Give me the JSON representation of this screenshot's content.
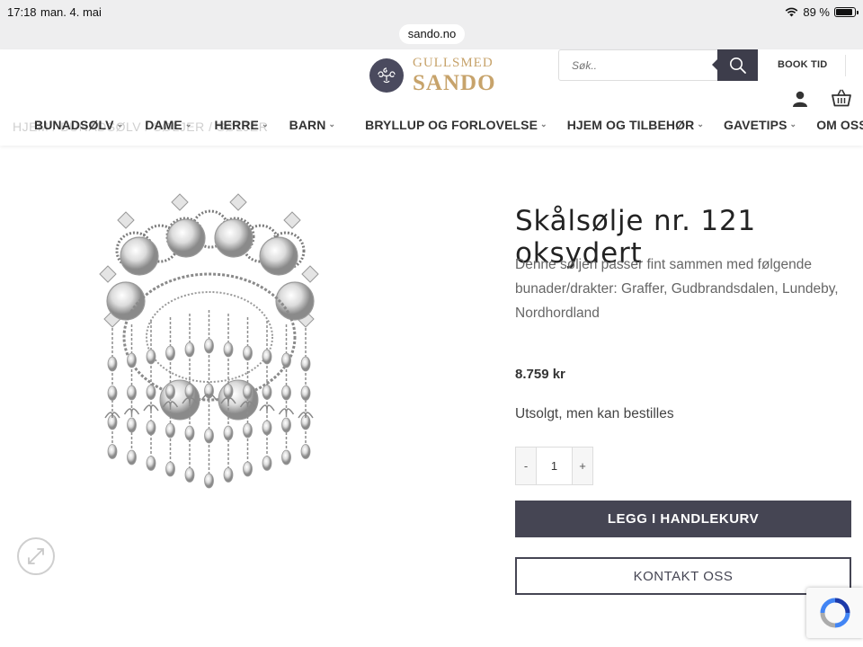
{
  "status_bar": {
    "time": "17:18",
    "date": "man. 4. mai",
    "battery": "89 %",
    "battery_level": 0.89
  },
  "browser": {
    "url": "sando.no"
  },
  "header": {
    "logo_top": "GULLSMED",
    "logo_bottom": "SANDO",
    "search_placeholder": "Søk..",
    "book_tid": "BOOK TID",
    "breadcrumb_ghost": "HJEM / BUNADSØLV / SØLJER / SØLJER"
  },
  "nav": {
    "items": [
      {
        "label": "BUNADSØLV"
      },
      {
        "label": "DAME"
      },
      {
        "label": "HERRE"
      },
      {
        "label": "BARN"
      },
      {
        "label": "BRYLLUP OG FORLOVELSE"
      },
      {
        "label": "HJEM OG TILBEHØR"
      },
      {
        "label": "GAVETIPS"
      },
      {
        "label": "OM OSS"
      }
    ]
  },
  "product": {
    "title": "Skålsølje nr. 121 oksydert",
    "description": "Denne søljen passer fint sammen med følgende bunader/drakter: Graffer, Gudbrandsdalen, Lundeby, Nordhordland",
    "price": "8.759 kr",
    "stock_status": "Utsolgt, men kan bestilles",
    "quantity": "1",
    "qty_minus": "-",
    "qty_plus": "+",
    "add_to_cart": "LEGG I HANDLEKURV",
    "contact": "KONTAKT OSS"
  },
  "colors": {
    "brand_gold": "#c7a36b",
    "button_dark": "#454553",
    "status_bar_bg": "#eeeeef"
  },
  "icons": [
    "wifi-icon",
    "battery-icon",
    "logo-mark-icon",
    "search-icon",
    "user-icon",
    "cart-icon",
    "chevron-down-icon",
    "zoom-icon",
    "recaptcha-icon"
  ]
}
